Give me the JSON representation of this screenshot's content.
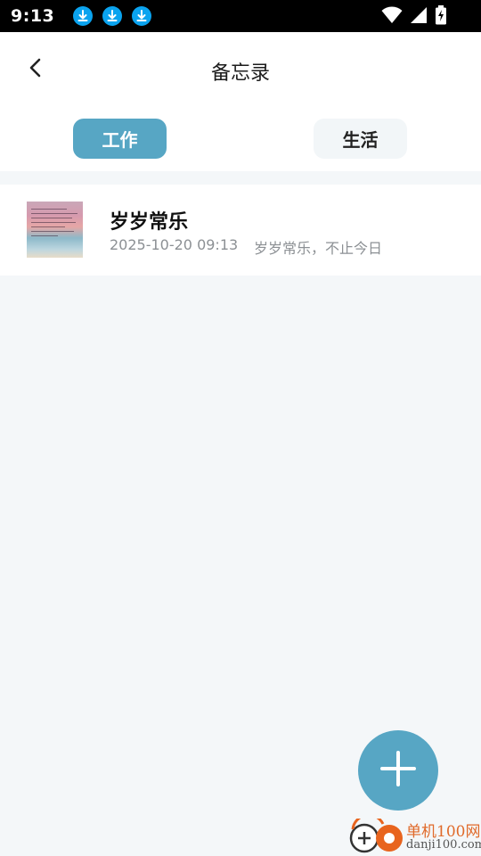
{
  "status_bar": {
    "time": "9:13",
    "icons": [
      "download-icon",
      "download-icon",
      "download-icon",
      "wifi-icon",
      "signal-icon",
      "battery-charging-icon"
    ]
  },
  "header": {
    "title": "备忘录",
    "back_icon": "chevron-left-icon"
  },
  "tabs": [
    {
      "label": "工作",
      "active": true
    },
    {
      "label": "生活",
      "active": false
    }
  ],
  "notes": [
    {
      "title": "岁岁常乐",
      "date": "2025-10-20 09:13",
      "preview": "岁岁常乐，不止今日",
      "thumbnail": "note-image-thumbnail"
    }
  ],
  "fab": {
    "icon": "plus-icon"
  },
  "watermark": {
    "cn": "单机100网",
    "en": "danji100.com"
  },
  "colors": {
    "accent": "#57a6c4",
    "background": "#f4f7f9",
    "status_bar": "#000000",
    "download_badge": "#0aa3ef"
  }
}
